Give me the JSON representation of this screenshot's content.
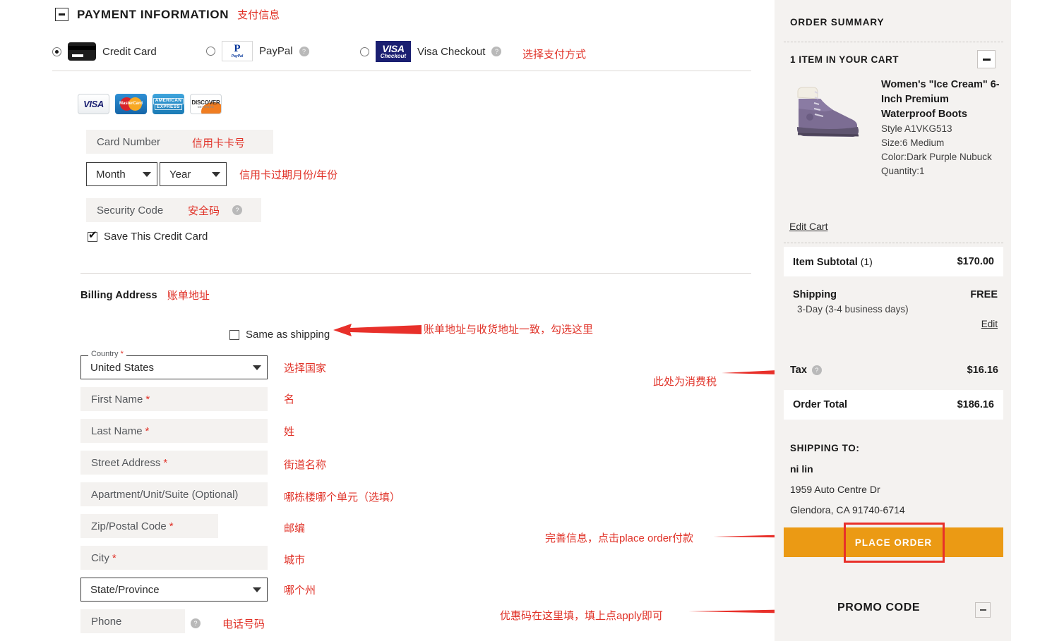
{
  "payment": {
    "section_title": "PAYMENT INFORMATION",
    "section_title_cn": "支付信息",
    "methods": [
      {
        "label": "Credit Card",
        "icon": "credit-card-icon",
        "selected": true,
        "has_help": false
      },
      {
        "label": "PayPal",
        "icon": "paypal-logo-icon",
        "selected": false,
        "has_help": true
      },
      {
        "label": "Visa Checkout",
        "icon": "visa-checkout-logo-icon",
        "selected": false,
        "has_help": true
      }
    ],
    "methods_note_cn": "选择支付方式",
    "card_brands": [
      "VISA",
      "MasterCard",
      "AMERICAN EXPRESS",
      "DISCOVER NETWORK"
    ],
    "card_number_placeholder": "Card Number",
    "card_number_note_cn": "信用卡卡号",
    "month_placeholder": "Month",
    "year_placeholder": "Year",
    "expiry_note_cn": "信用卡过期月份/年份",
    "security_code_placeholder": "Security Code",
    "security_code_note_cn": "安全码",
    "save_card_label": "Save This Credit Card",
    "save_card_checked": true
  },
  "billing": {
    "title": "Billing Address",
    "title_cn": "账单地址",
    "same_as_shipping_label": "Same as shipping",
    "same_as_shipping_checked": false,
    "same_as_shipping_note_cn": "账单地址与收货地址一致，勾选这里",
    "country_label": "Country",
    "country_value": "United States",
    "country_note_cn": "选择国家",
    "fields": [
      {
        "placeholder": "First Name",
        "required": true,
        "note_cn": "名"
      },
      {
        "placeholder": "Last Name",
        "required": true,
        "note_cn": "姓"
      },
      {
        "placeholder": "Street Address",
        "required": true,
        "note_cn": "街道名称"
      },
      {
        "placeholder": "Apartment/Unit/Suite (Optional)",
        "required": false,
        "note_cn": "哪栋楼哪个单元（选填）"
      },
      {
        "placeholder": "Zip/Postal Code",
        "required": true,
        "note_cn": "邮编"
      },
      {
        "placeholder": "City",
        "required": true,
        "note_cn": "城市"
      }
    ],
    "state_placeholder": "State/Province",
    "state_note_cn": "哪个州",
    "phone_placeholder": "Phone",
    "phone_note_cn": "电话号码"
  },
  "summary": {
    "title": "ORDER SUMMARY",
    "cart_count_label": "1 ITEM IN YOUR CART",
    "product": {
      "name": "Women's \"Ice Cream\" 6-Inch Premium Waterproof Boots",
      "style": "Style A1VKG513",
      "size": "Size:6 Medium",
      "color": "Color:Dark Purple Nubuck",
      "quantity": "Quantity:1"
    },
    "edit_cart_label": "Edit Cart",
    "item_subtotal_label": "Item Subtotal",
    "item_subtotal_count": "(1)",
    "item_subtotal_value": "$170.00",
    "shipping_label": "Shipping",
    "shipping_value": "FREE",
    "shipping_method": "3-Day  (3-4 business days)",
    "shipping_edit_label": "Edit",
    "tax_label": "Tax",
    "tax_value": "$16.16",
    "tax_note_cn": "此处为消费税",
    "order_total_label": "Order Total",
    "order_total_value": "$186.16",
    "shipping_to_label": "SHIPPING TO:",
    "shipping_to_name": "ni lin",
    "shipping_to_street": "1959 Auto Centre Dr",
    "shipping_to_city": "Glendora, CA 91740-6714",
    "place_order_label": "PLACE ORDER",
    "place_order_note_cn": "完善信息，点击place order付款"
  },
  "promo": {
    "title": "PROMO CODE",
    "note_cn": "优惠码在这里填，填上点apply即可"
  },
  "colors": {
    "accent_orange": "#eb9a14",
    "annotation_red": "#e03127",
    "panel_bg": "#f4f2f0"
  }
}
